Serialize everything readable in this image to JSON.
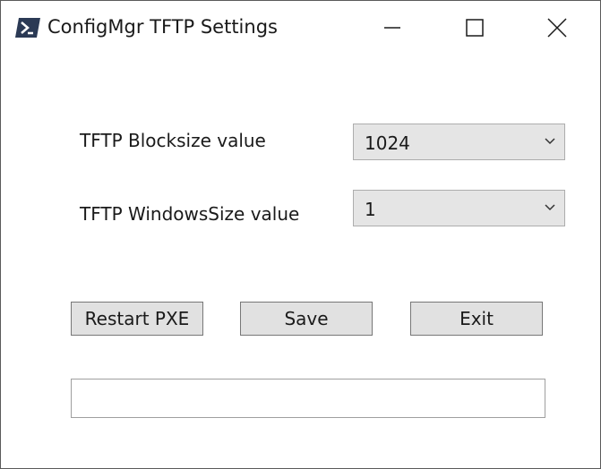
{
  "window": {
    "title": "ConfigMgr TFTP Settings",
    "icon": "powershell-icon",
    "controls": [
      "minimize-icon",
      "maximize-icon",
      "close-icon"
    ]
  },
  "form": {
    "blocksize_label": "TFTP Blocksize value",
    "blocksize_value": "1024",
    "windowsize_label": "TFTP WindowsSize value",
    "windowsize_value": "1"
  },
  "buttons": {
    "restart_label": "Restart PXE",
    "save_label": "Save",
    "exit_label": "Exit"
  },
  "status": {
    "text": ""
  }
}
